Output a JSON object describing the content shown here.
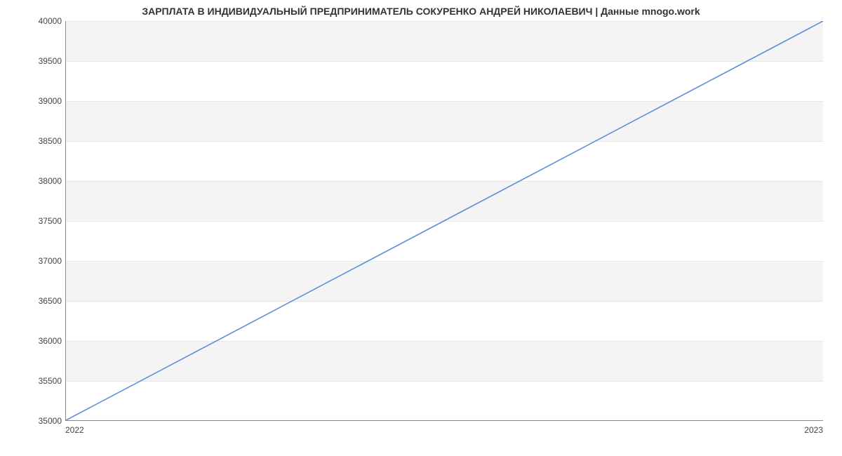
{
  "chart_data": {
    "type": "line",
    "title": "ЗАРПЛАТА В ИНДИВИДУАЛЬНЫЙ ПРЕДПРИНИМАТЕЛЬ СОКУРЕНКО АНДРЕЙ НИКОЛАЕВИЧ | Данные mnogo.work",
    "x": [
      "2022",
      "2023"
    ],
    "values": [
      35000,
      40000
    ],
    "xlabel": "",
    "ylabel": "",
    "ylim": [
      35000,
      40000
    ],
    "y_ticks": [
      35000,
      35500,
      36000,
      36500,
      37000,
      37500,
      38000,
      38500,
      39000,
      39500,
      40000
    ],
    "line_color": "#5b8fd6"
  }
}
